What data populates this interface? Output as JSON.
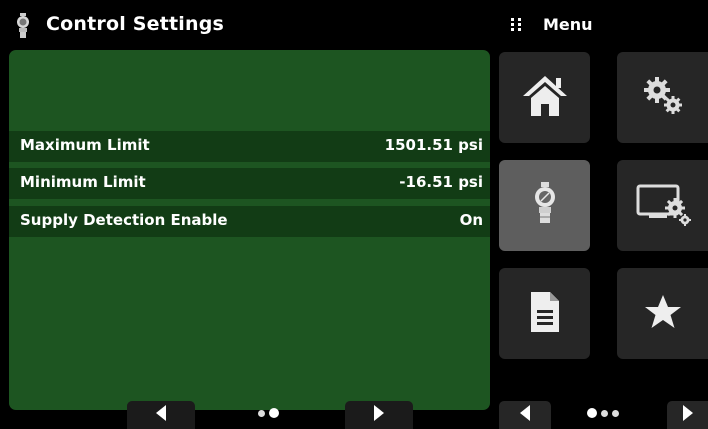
{
  "header": {
    "title": "Control Settings",
    "title_icon": "pressure-regulator-icon"
  },
  "menu": {
    "label": "Menu",
    "icon": "grid-dots-icon"
  },
  "settings": [
    {
      "label": "Maximum Limit",
      "value": "1501.51 psi"
    },
    {
      "label": "Minimum Limit",
      "value": "-16.51 psi"
    },
    {
      "label": "Supply Detection Enable",
      "value": "On"
    }
  ],
  "pager_left": {
    "pages": 2,
    "current_page": 2
  },
  "pager_right": {
    "pages": 3,
    "current_page": 1
  },
  "tiles": [
    {
      "name": "home",
      "icon": "home-icon"
    },
    {
      "name": "settings",
      "icon": "gears-icon"
    },
    {
      "name": "control",
      "icon": "pressure-regulator-icon",
      "active": true
    },
    {
      "name": "display-settings",
      "icon": "monitor-gear-icon"
    },
    {
      "name": "document",
      "icon": "document-icon"
    },
    {
      "name": "favorites",
      "icon": "star-icon"
    }
  ],
  "colors": {
    "panel": "#1d5521",
    "row": "#123c15",
    "tile": "#262626",
    "tile_active": "#5e5e5e"
  }
}
